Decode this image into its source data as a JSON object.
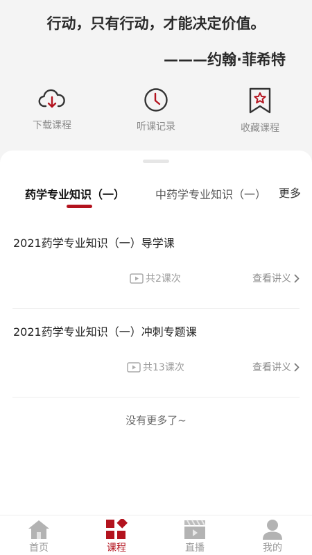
{
  "header": {
    "quote": "行动，只有行动，才能决定价值。",
    "author": "———约翰·菲希特"
  },
  "shortcuts": [
    {
      "label": "下载课程",
      "icon": "cloud-download-icon"
    },
    {
      "label": "听课记录",
      "icon": "clock-icon"
    },
    {
      "label": "收藏课程",
      "icon": "bookmark-star-icon"
    }
  ],
  "tabs": {
    "active": "药学专业知识（一）",
    "second": "中药学专业知识（一）",
    "more": "更多"
  },
  "courses": [
    {
      "title": "2021药学专业知识（一）导学课",
      "count": "共2课次",
      "notes": "查看讲义"
    },
    {
      "title": "2021药学专业知识（一）冲刺专题课",
      "count": "共13课次",
      "notes": "查看讲义"
    }
  ],
  "footer_text": "没有更多了~",
  "nav": [
    {
      "label": "首页",
      "icon": "home-icon"
    },
    {
      "label": "课程",
      "icon": "course-grid-icon"
    },
    {
      "label": "直播",
      "icon": "live-video-icon"
    },
    {
      "label": "我的",
      "icon": "profile-icon"
    }
  ],
  "colors": {
    "accent": "#b3131e",
    "page_bg": "#f4f4f4"
  }
}
